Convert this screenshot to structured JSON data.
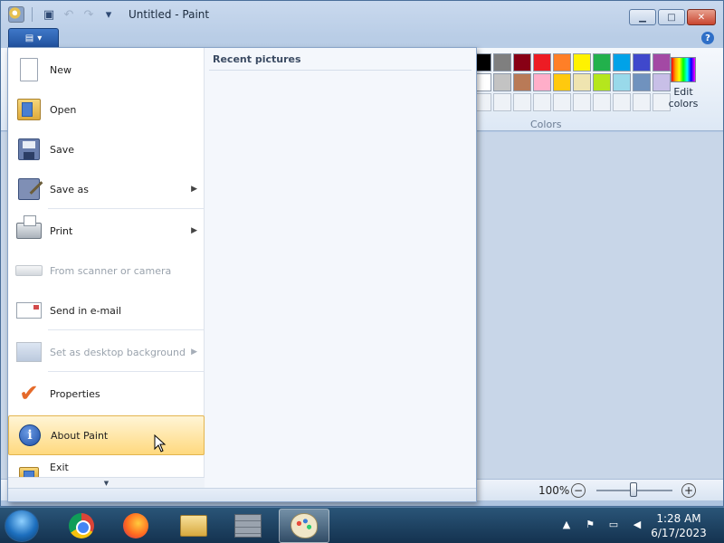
{
  "window": {
    "title": "Untitled - Paint",
    "controls": {
      "minimize": "▁",
      "maximize": "□",
      "close": "✕"
    }
  },
  "quick_access": {
    "save_icon": "floppy-icon",
    "undo_icon": "undo-icon",
    "redo_icon": "redo-icon",
    "customize_icon": "dropdown-icon"
  },
  "ribbon": {
    "file_button_icon": "menu-icon",
    "help_label": "?",
    "colors": {
      "label": "Colors",
      "row1": [
        "#000000",
        "#7f7f7f",
        "#880015",
        "#ed1c24",
        "#ff7f27",
        "#fff200",
        "#22b14c",
        "#00a2e8",
        "#3f48cc",
        "#a349a4"
      ],
      "row2": [
        "#ffffff",
        "#c3c3c3",
        "#b97a57",
        "#ffaec9",
        "#ffc90e",
        "#efe4b0",
        "#b5e61d",
        "#99d9ea",
        "#7092be",
        "#c8bfe7"
      ],
      "row3_empty": 10
    },
    "edit_colors_label": "Edit colors"
  },
  "file_menu": {
    "items": [
      {
        "label": "New",
        "icon": "new-document-icon",
        "disabled": false,
        "submenu": false
      },
      {
        "label": "Open",
        "icon": "open-folder-icon",
        "disabled": false,
        "submenu": false
      },
      {
        "label": "Save",
        "icon": "save-icon",
        "disabled": false,
        "submenu": false
      },
      {
        "label": "Save as",
        "icon": "save-as-icon",
        "disabled": false,
        "submenu": true
      },
      {
        "label": "Print",
        "icon": "printer-icon",
        "disabled": false,
        "submenu": true
      },
      {
        "label": "From scanner or camera",
        "icon": "scanner-icon",
        "disabled": true,
        "submenu": false
      },
      {
        "label": "Send in e-mail",
        "icon": "email-icon",
        "disabled": false,
        "submenu": false
      },
      {
        "label": "Set as desktop background",
        "icon": "desktop-icon",
        "disabled": true,
        "submenu": true
      },
      {
        "label": "Properties",
        "icon": "checkmark-icon",
        "disabled": false,
        "submenu": false
      },
      {
        "label": "About Paint",
        "icon": "info-icon",
        "disabled": false,
        "submenu": false,
        "hovered": true
      },
      {
        "label": "Exit",
        "icon": "exit-icon",
        "disabled": false,
        "submenu": false
      }
    ],
    "recent_title": "Recent pictures",
    "scroll_down_icon": "scroll-down-arrow-icon"
  },
  "statusbar": {
    "zoom": "100%",
    "zoom_level_percent": 100,
    "zoom_out": "−",
    "zoom_in": "+"
  },
  "taskbar": {
    "apps": [
      "Chrome",
      "Firefox",
      "File Explorer",
      "Firewall",
      "Paint"
    ],
    "active_app": "Paint",
    "clock": {
      "time": "1:28 AM",
      "date": "6/17/2023"
    }
  }
}
